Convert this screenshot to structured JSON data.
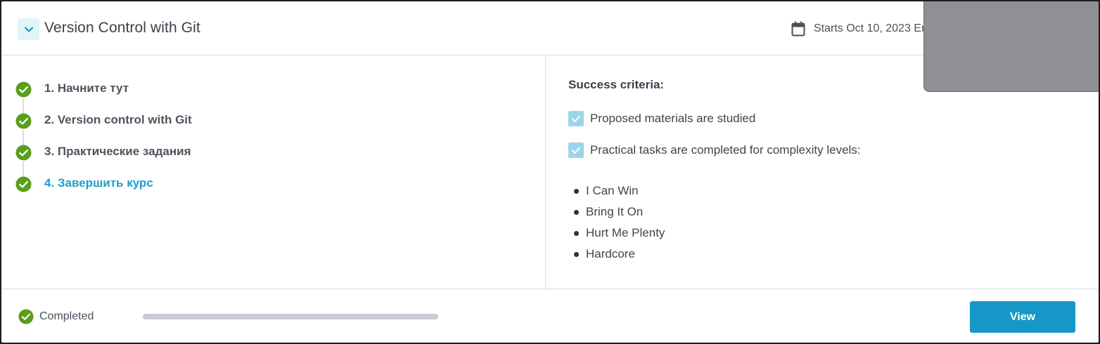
{
  "course": {
    "title": "Version Control with Git",
    "dates": "Starts Oct 10, 2023 En"
  },
  "steps": [
    {
      "label": "1. Начните тут",
      "status": "done"
    },
    {
      "label": "2. Version control with Git",
      "status": "done"
    },
    {
      "label": "3. Практические задания",
      "status": "done"
    },
    {
      "label": "4. Завершить курс",
      "status": "done",
      "active": true
    }
  ],
  "criteria": {
    "title": "Success criteria:",
    "items": [
      {
        "label": "Proposed materials are studied",
        "checked": true
      },
      {
        "label": "Practical tasks are completed for complexity levels:",
        "checked": true
      }
    ],
    "levels": [
      "I Can Win",
      "Bring It On",
      "Hurt Me Plenty",
      "Hardcore"
    ]
  },
  "footer": {
    "status": "Completed",
    "progress": 1.0,
    "view_label": "View"
  },
  "colors": {
    "accent": "#1598c8",
    "check_green": "#5a9e1b",
    "active_link": "#1aa0cb",
    "checkbox": "#9bd5ec"
  },
  "icons": {
    "toggle": "chevron-down-icon",
    "calendar": "calendar-icon",
    "step": "check-circle-icon",
    "criterion": "checkbox-checked-icon"
  }
}
